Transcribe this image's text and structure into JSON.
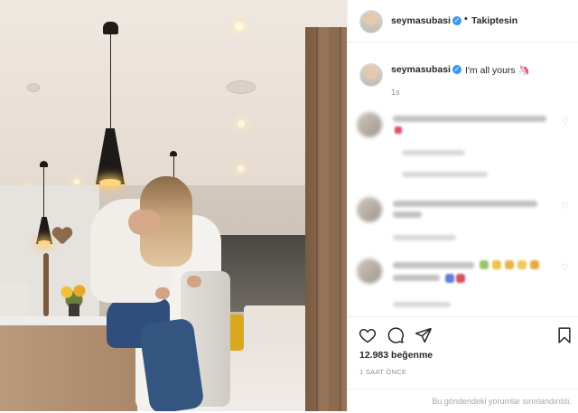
{
  "post": {
    "image_alt": "",
    "author": {
      "username": "seymasubasi",
      "verified": true,
      "follow_separator": "•",
      "follow_label": "Takiptesin"
    },
    "caption": {
      "username": "seymasubasi",
      "text": "I'm all yours 🦄",
      "age": "1s"
    },
    "likes": "12.983 beğenme",
    "timestamp": "1 SAAT ÖNCE",
    "comments_notice": "Bu gönderideki yorumlar sınırlandırıldı."
  },
  "icons": {
    "like": "heart-outline-icon",
    "comment": "speech-bubble-icon",
    "share": "paper-plane-icon",
    "save": "bookmark-icon",
    "more": "ellipsis-icon",
    "verified": "verified-check-icon"
  },
  "colors": {
    "verified_blue": "#3897f0",
    "text_primary": "#262626",
    "text_secondary": "#8e8e8e",
    "divider": "#efefef"
  }
}
